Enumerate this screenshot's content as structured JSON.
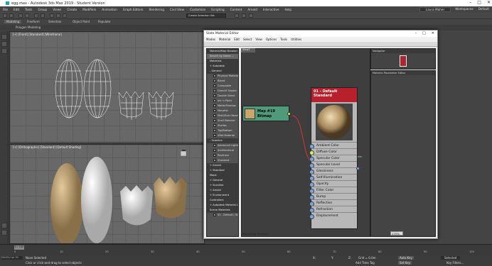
{
  "title": "egg.max - Autodesk 3ds Max 2019 - Student Version",
  "menu": [
    "File",
    "Edit",
    "Tools",
    "Group",
    "Views",
    "Create",
    "Modifiers",
    "Animation",
    "Graph Editors",
    "Rendering",
    "Civil View",
    "Customize",
    "Scripting",
    "Content",
    "Arnold",
    "Interactive",
    "Help"
  ],
  "signin": "Laura Maher",
  "workspace_label": "Workspaces:",
  "workspace": "Default",
  "selection_set": "Create Selection Set",
  "ribbon_tabs": [
    "Modeling",
    "Freeform",
    "Selection",
    "Object Paint",
    "Populate"
  ],
  "polygon_modeling": "Polygon Modeling",
  "vp_top_label": "[+] [Front] [Standard] [Wireframe]",
  "vp_bottom_label": "[+] [Orthographic] [Standard] [Default Shading]",
  "slate": {
    "title": "Slate Material Editor",
    "menu": [
      "Modes",
      "Material",
      "Edit",
      "Select",
      "View",
      "Options",
      "Tools",
      "Utilities"
    ],
    "view_tab": "View1",
    "search": "Search by Name ...",
    "browser_header": "Material/Map Browser",
    "browser": [
      {
        "type": "head",
        "label": "Materials"
      },
      {
        "type": "head",
        "label": "+ Autodesk"
      },
      {
        "type": "head",
        "label": "- General"
      },
      {
        "type": "item",
        "label": "Physical Material"
      },
      {
        "type": "item",
        "label": "Blend"
      },
      {
        "type": "item",
        "label": "Composite"
      },
      {
        "type": "item",
        "label": "DirectX Shader"
      },
      {
        "type": "item",
        "label": "Double Sided"
      },
      {
        "type": "item",
        "label": "Ink 'n Paint"
      },
      {
        "type": "item",
        "label": "Matte/Shadow"
      },
      {
        "type": "item",
        "label": "Morpher"
      },
      {
        "type": "item",
        "label": "Multi/Sub-Object"
      },
      {
        "type": "item",
        "label": "Shell Material"
      },
      {
        "type": "item",
        "label": "Shellac"
      },
      {
        "type": "item",
        "label": "Top/Bottom"
      },
      {
        "type": "item",
        "label": "XRef Material"
      },
      {
        "type": "head",
        "label": "- Scanline"
      },
      {
        "type": "item",
        "label": "Advanced Lighti..."
      },
      {
        "type": "item",
        "label": "Architectural"
      },
      {
        "type": "item",
        "label": "Raytrace"
      },
      {
        "type": "item",
        "label": "Standard"
      },
      {
        "type": "head",
        "label": "+ Arnold"
      },
      {
        "type": "head",
        "label": "+ Standard"
      },
      {
        "type": "head",
        "label": "Maps"
      },
      {
        "type": "head",
        "label": "+ General"
      },
      {
        "type": "head",
        "label": "+ Scanline"
      },
      {
        "type": "head",
        "label": "+ Arnold"
      },
      {
        "type": "head",
        "label": "+ Environment"
      },
      {
        "type": "head",
        "label": "Controllers"
      },
      {
        "type": "head",
        "label": "+ Autodesk Material Lib..."
      },
      {
        "type": "head",
        "label": "Scene Materials"
      },
      {
        "type": "item",
        "label": "01 - Default  ( Sta..."
      }
    ],
    "navigator": "Navigator",
    "param_editor": "Material Parameter Editor",
    "bitmap_node": {
      "title": "Map #19",
      "subtitle": "Bitmap"
    },
    "std_node": {
      "title": "01 - Default",
      "subtitle": "Standard"
    },
    "slots": [
      "Ambient Color",
      "Diffuse Color",
      "Specular Color",
      "Specular Level",
      "Glossiness",
      "Self-Illumination",
      "Opacity",
      "Filter Color",
      "Bump",
      "Reflection",
      "Refraction",
      "Displacement"
    ],
    "status": "Rendering finished",
    "zoom": "170%"
  },
  "timeline": {
    "frame": "0 / 100",
    "ticks": [
      "0",
      "10",
      "20",
      "30",
      "40",
      "50",
      "60",
      "70",
      "80",
      "90",
      "100"
    ]
  },
  "status": {
    "selection": "None Selected",
    "hint": "Click or click-and-drag to select objects",
    "script": "MAXScript Mi",
    "x": "X:",
    "y": "Y:",
    "z": "Z:",
    "grid": "Grid = 0.0m",
    "time_tag": "Add Time Tag",
    "autokey": "Auto Key",
    "set_key": "Set Key",
    "selected": "Selected",
    "filters": "Key Filters..."
  },
  "colors": {
    "accent": "#b8202b",
    "bitmap": "#4f9a7a",
    "socket": "#7fa6d8"
  }
}
